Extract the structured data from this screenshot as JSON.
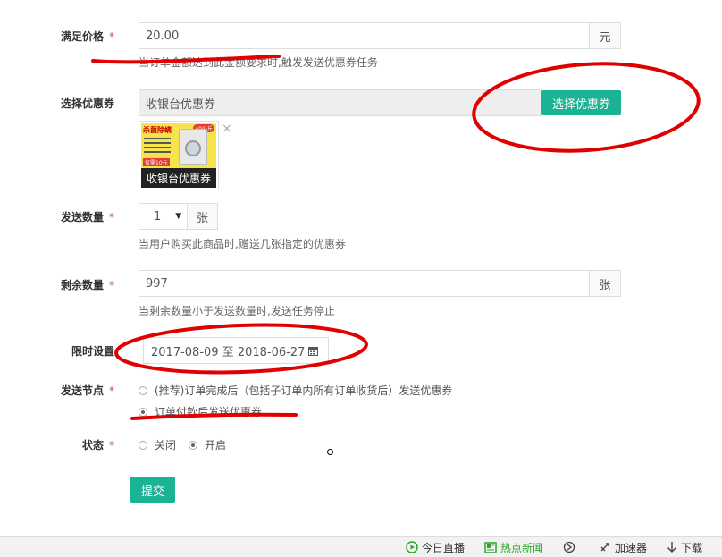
{
  "form": {
    "price": {
      "label": "满足价格",
      "value": "20.00",
      "unit": "元",
      "help": "当订单金额达到此金额要求时,触发发送优惠券任务"
    },
    "coupon": {
      "label": "选择优惠券",
      "value": "收银台优惠券",
      "button": "选择优惠券",
      "thumb_caption": "收银台优惠券",
      "thumb_banner": "杀菌除螨",
      "thumb_tag": "40公斤",
      "thumb_price": "仅需10元",
      "remove": "×"
    },
    "send_count": {
      "label": "发送数量",
      "value": "1",
      "unit": "张",
      "help": "当用户购买此商品时,赠送几张指定的优惠券"
    },
    "remaining": {
      "label": "剩余数量",
      "value": "997",
      "unit": "张",
      "help": "当剩余数量小于发送数量时,发送任务停止"
    },
    "time_limit": {
      "label": "限时设置",
      "value": "2017-08-09 至 2018-06-27"
    },
    "send_node": {
      "label": "发送节点",
      "options": [
        "(推荐)订单完成后（包括子订单内所有订单收货后）发送优惠券",
        "订单付款后发送优惠券"
      ],
      "selected": 1
    },
    "status": {
      "label": "状态",
      "options": [
        "关闭",
        "开启"
      ],
      "selected": 1
    },
    "required_mark": "*",
    "submit": "提交"
  },
  "bottombar": {
    "items": [
      {
        "label": "今日直播",
        "icon": "play-circle-icon",
        "color": "#2aa52a"
      },
      {
        "label": "热点新闻",
        "icon": "news-icon",
        "color": "#2aa52a"
      },
      {
        "label": "",
        "icon": "refresh-icon",
        "color": "#444444"
      },
      {
        "label": "加速器",
        "icon": "rocket-icon",
        "color": "#444444"
      },
      {
        "label": "下载",
        "icon": "download-arrow-icon",
        "color": "#444444"
      }
    ]
  },
  "colors": {
    "accent": "#1ab394",
    "required": "#e4393c",
    "annotation": "#e00000"
  }
}
